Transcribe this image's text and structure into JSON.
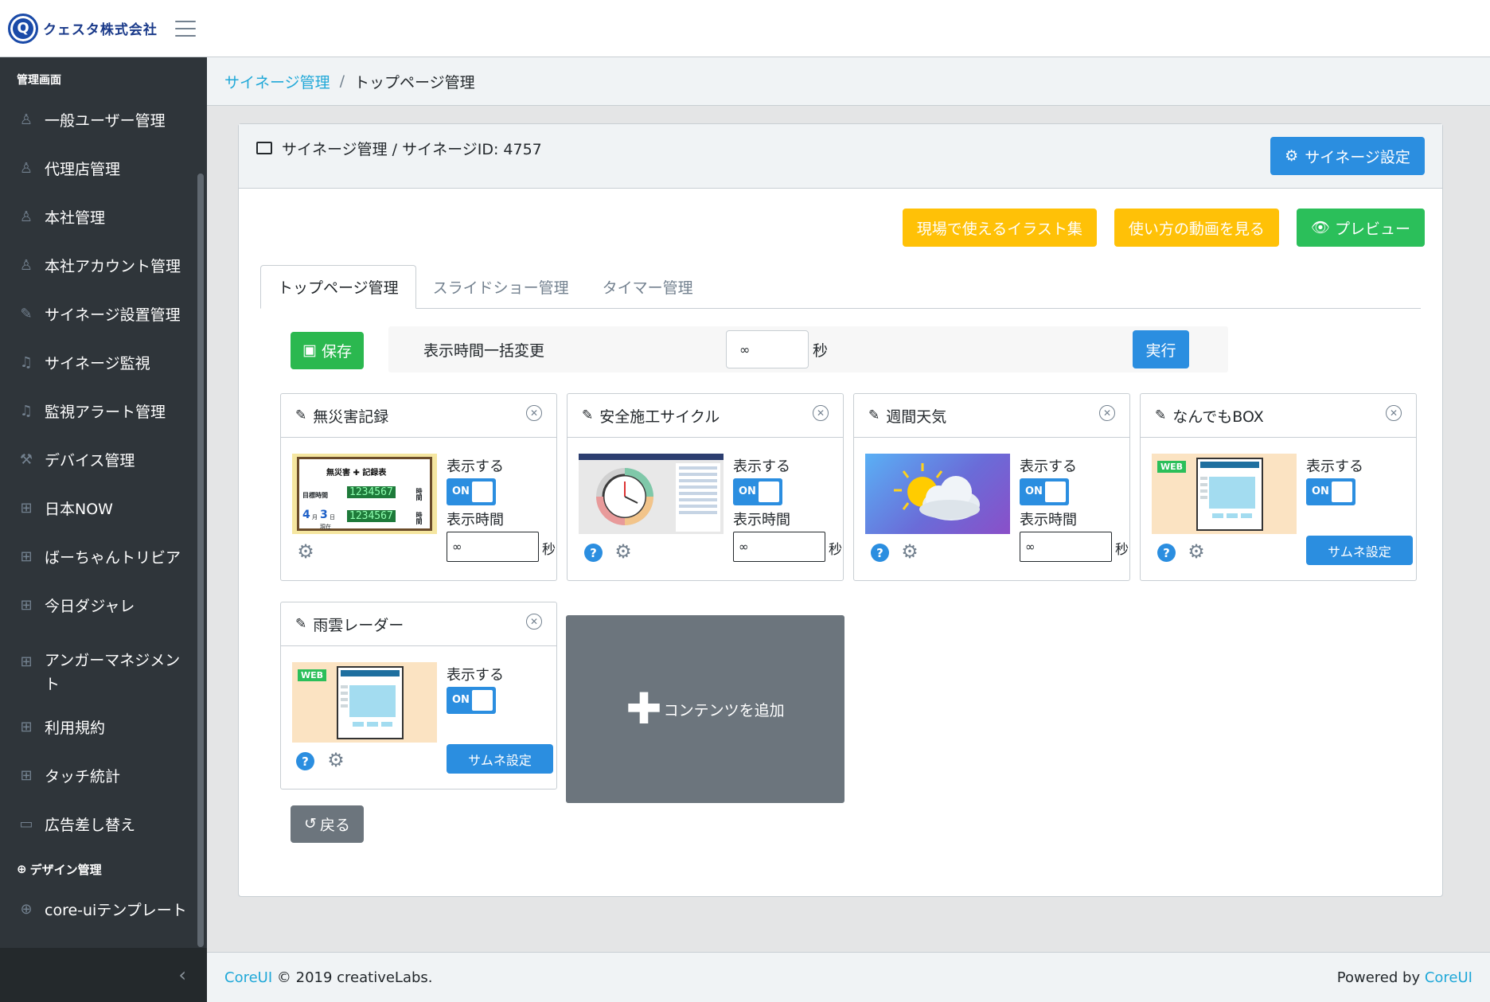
{
  "brand": {
    "logo_letter": "Q",
    "name": "クェスタ株式会社"
  },
  "sidebar": {
    "section_title": "管理画面",
    "items": [
      {
        "label": "一般ユーザー管理",
        "icon": "user-icon"
      },
      {
        "label": "代理店管理",
        "icon": "user-icon"
      },
      {
        "label": "本社管理",
        "icon": "user-icon"
      },
      {
        "label": "本社アカウント管理",
        "icon": "user-icon"
      },
      {
        "label": "サイネージ設置管理",
        "icon": "pin-icon"
      },
      {
        "label": "サイネージ監視",
        "icon": "bell-icon"
      },
      {
        "label": "監視アラート管理",
        "icon": "bell-icon"
      },
      {
        "label": "デバイス管理",
        "icon": "wrench-icon"
      },
      {
        "label": "日本NOW",
        "icon": "grid-icon"
      },
      {
        "label": "ばーちゃんトリビア",
        "icon": "grid-icon"
      },
      {
        "label": "今日ダジャレ",
        "icon": "grid-icon"
      },
      {
        "label": "アンガーマネジメント",
        "icon": "grid-icon"
      },
      {
        "label": "利用規約",
        "icon": "grid-icon"
      },
      {
        "label": "タッチ統計",
        "icon": "grid-icon"
      },
      {
        "label": "広告差し替え",
        "icon": "monitor-icon"
      }
    ],
    "section2_title": "デザイン管理",
    "items2": [
      {
        "label": "core-uiテンプレート",
        "icon": "globe-icon"
      }
    ]
  },
  "breadcrumb": {
    "parent": "サイネージ管理",
    "separator": "/",
    "current": "トップページ管理"
  },
  "card": {
    "title": "サイネージ管理 / サイネージID: 4757",
    "settings_button": "サイネージ設定",
    "buttons": {
      "illustrations": "現場で使えるイラスト集",
      "video": "使い方の動画を見る",
      "preview": "プレビュー"
    }
  },
  "tabs": [
    "トップページ管理",
    "スライドショー管理",
    "タイマー管理"
  ],
  "toolbar": {
    "save": "保存",
    "bulk_label": "表示時間一括変更",
    "bulk_value": "∞",
    "unit": "秒",
    "execute": "実行"
  },
  "contents": [
    {
      "title": "無災害記録",
      "show_label": "表示する",
      "toggle": "ON",
      "time_label": "表示時間",
      "time_value": "∞",
      "unit": "秒",
      "thumb": {
        "title": "無災害 ✚ 記録表",
        "label1": "目標時間",
        "digits1": "1234567",
        "side1": "時間",
        "digits2": "1234567",
        "side2": "時間",
        "month": "4",
        "day": "3",
        "month_unit": "月",
        "day_unit": "日",
        "present": "現在"
      }
    },
    {
      "title": "安全施工サイクル",
      "show_label": "表示する",
      "toggle": "ON",
      "time_label": "表示時間",
      "time_value": "∞",
      "unit": "秒"
    },
    {
      "title": "週間天気",
      "show_label": "表示する",
      "toggle": "ON",
      "time_label": "表示時間",
      "time_value": "∞",
      "unit": "秒"
    },
    {
      "title": "なんでもBOX",
      "show_label": "表示する",
      "toggle": "ON",
      "thumb_button": "サムネ設定",
      "badge": "WEB"
    },
    {
      "title": "雨雲レーダー",
      "show_label": "表示する",
      "toggle": "ON",
      "thumb_button": "サムネ設定",
      "badge": "WEB"
    }
  ],
  "add_content": "コンテンツを追加",
  "back": "戻る",
  "footer": {
    "brand": "CoreUI",
    "copyright": "© 2019 creativeLabs.",
    "powered": "Powered by",
    "powered_link": "CoreUI"
  }
}
